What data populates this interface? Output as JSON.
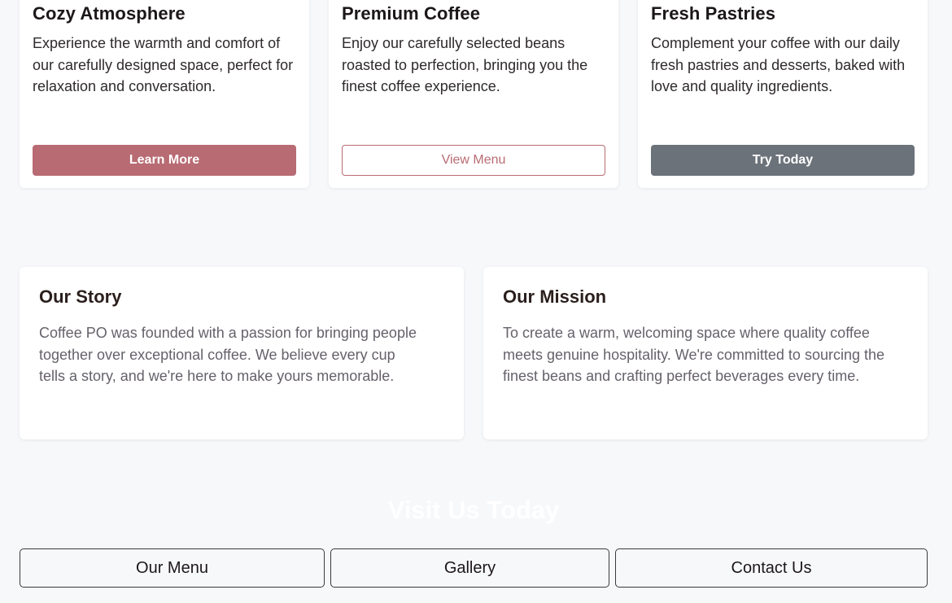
{
  "features": [
    {
      "title": "Cozy Atmosphere",
      "text": "Experience the warmth and comfort of our carefully designed space, perfect for relaxation and conversation.",
      "button": "Learn More"
    },
    {
      "title": "Premium Coffee",
      "text": "Enjoy our carefully selected beans roasted to perfection, bringing you the finest coffee experience.",
      "button": "View Menu"
    },
    {
      "title": "Fresh Pastries",
      "text": "Complement your coffee with our daily fresh pastries and desserts, baked with love and quality ingredients.",
      "button": "Try Today"
    }
  ],
  "about": {
    "story": {
      "title": "Our Story",
      "text": "Coffee PO was founded with a passion for bringing people together over exceptional coffee. We believe every cup tells a story, and we're here to make yours memorable."
    },
    "mission": {
      "title": "Our Mission",
      "text": "To create a warm, welcoming space where quality coffee meets genuine hospitality. We're committed to sourcing the finest beans and crafting perfect beverages every time."
    }
  },
  "visit": {
    "title": "Visit Us Today",
    "buttons": [
      "Our Menu",
      "Gallery",
      "Contact Us"
    ]
  },
  "colors": {
    "accent": "#b86b73",
    "secondary": "#6c727a",
    "background": "#f7f8fa"
  }
}
